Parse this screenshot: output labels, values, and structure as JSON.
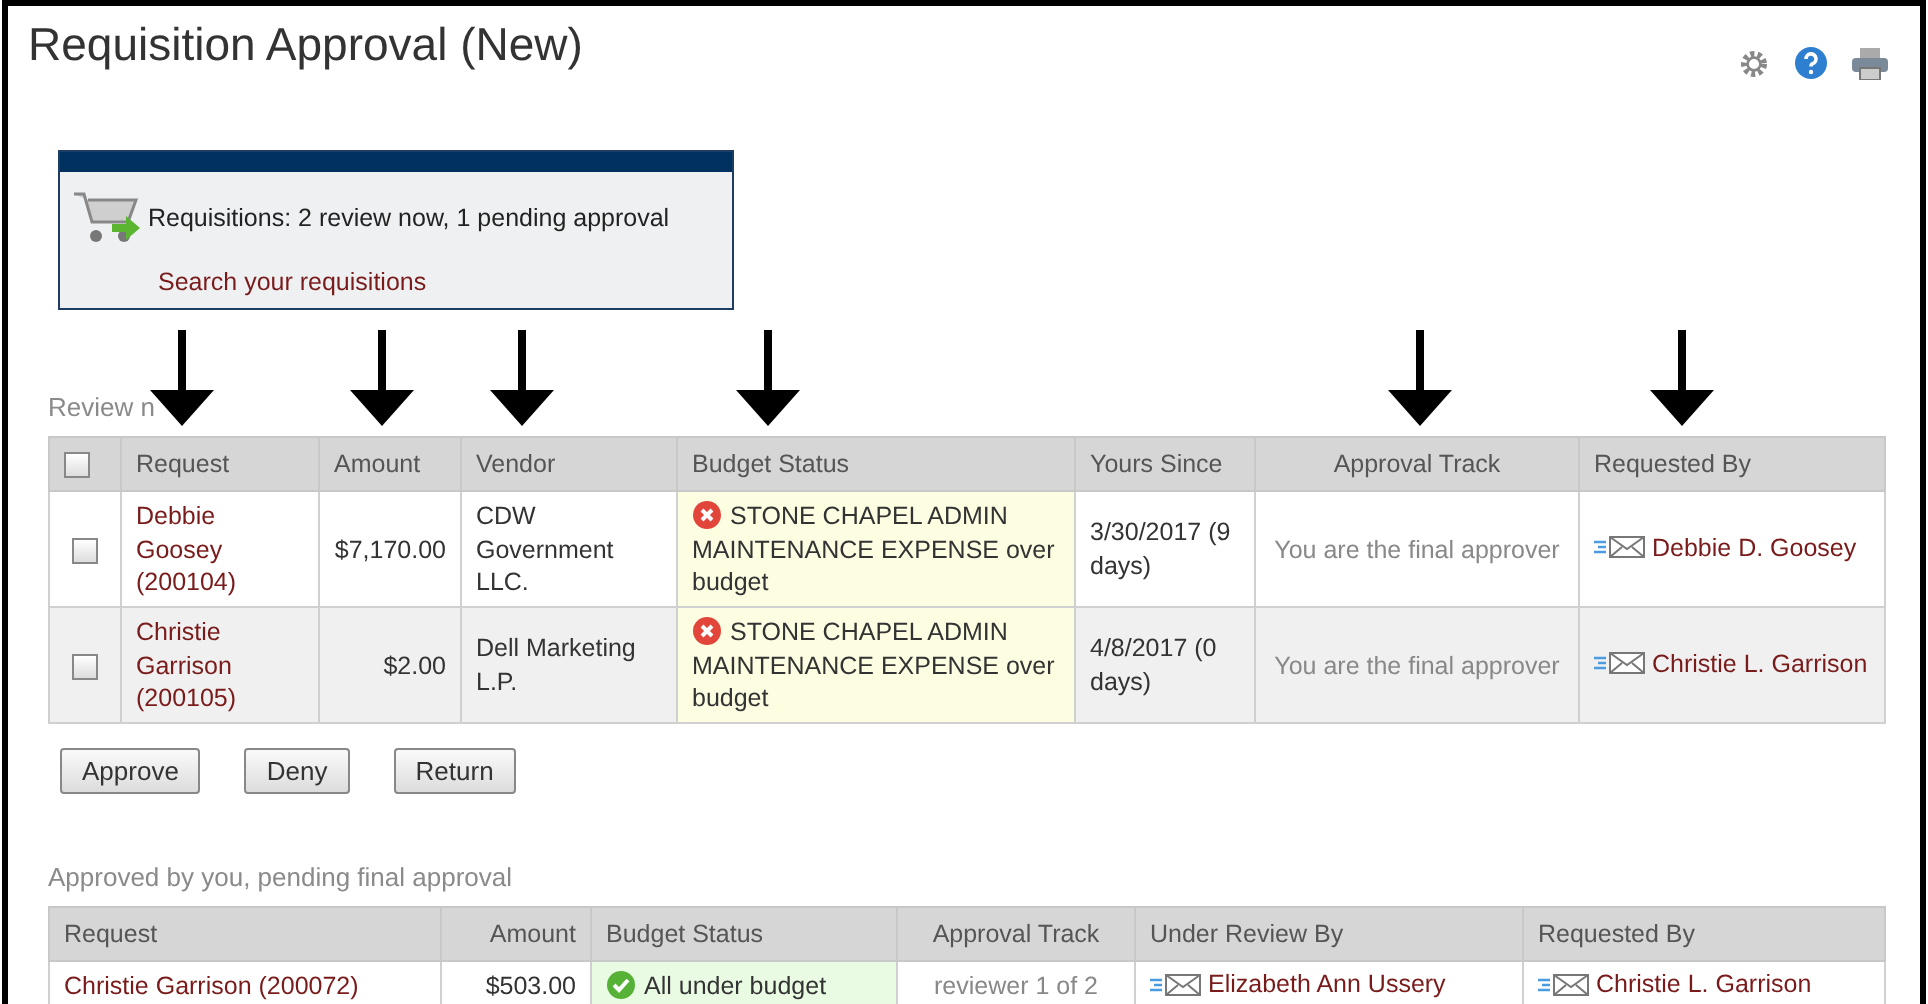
{
  "page": {
    "title": "Requisition Approval (New)"
  },
  "summary": {
    "text": "Requisitions: 2 review now, 1 pending approval",
    "link": "Search your requisitions"
  },
  "review_now": {
    "label": "Review n",
    "select_all": {
      "checked": false
    },
    "columns": [
      "Request",
      "Amount",
      "Vendor",
      "Budget Status",
      "Yours Since",
      "Approval Track",
      "Requested By"
    ],
    "rows": [
      {
        "checked": false,
        "request": "Debbie Goosey (200104)",
        "amount": "$7,170.00",
        "vendor": "CDW Government LLC.",
        "budget_status": {
          "kind": "over",
          "text": "STONE CHAPEL ADMIN MAINTENANCE EXPENSE over budget"
        },
        "yours_since": "3/30/2017 (9 days)",
        "approval_track": "You are the final approver",
        "requested_by": "Debbie D. Goosey"
      },
      {
        "checked": false,
        "request": "Christie Garrison (200105)",
        "amount": "$2.00",
        "vendor": "Dell Marketing L.P.",
        "budget_status": {
          "kind": "over",
          "text": "STONE CHAPEL ADMIN MAINTENANCE EXPENSE over budget"
        },
        "yours_since": "4/8/2017 (0 days)",
        "approval_track": "You are the final approver",
        "requested_by": "Christie L. Garrison"
      }
    ],
    "buttons": [
      "Approve",
      "Deny",
      "Return"
    ]
  },
  "pending": {
    "label": "Approved by you, pending final approval",
    "columns": [
      "Request",
      "Amount",
      "Budget Status",
      "Approval Track",
      "Under Review By",
      "Requested By"
    ],
    "rows": [
      {
        "request": "Christie Garrison (200072)",
        "amount": "$503.00",
        "budget_status": {
          "kind": "under",
          "text": "All under budget"
        },
        "approval_track": "reviewer 1 of 2",
        "under_review_by": "Elizabeth Ann Ussery",
        "requested_by": "Christie L. Garrison"
      }
    ]
  }
}
